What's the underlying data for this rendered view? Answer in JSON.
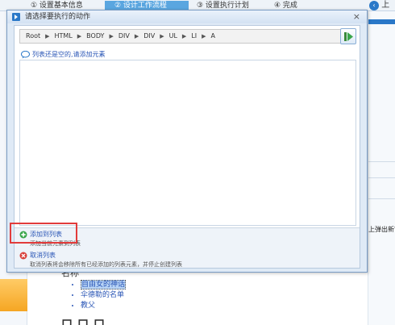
{
  "background": {
    "steps": [
      {
        "label": "① 设置基本信息"
      },
      {
        "label": "② 设计工作流程"
      },
      {
        "label": "③ 设置执行计划"
      },
      {
        "label": "④ 完成"
      }
    ],
    "nav_label": "上",
    "right_text": "上弹出新窗",
    "name_label": "名称",
    "list_items": [
      "自由女的神话",
      "伞德勒的名单",
      "教父"
    ],
    "bottom_text": "口口口"
  },
  "dialog": {
    "title": "请选择要执行的动作",
    "close_glyph": "×",
    "breadcrumb": [
      "Root",
      "HTML",
      "BODY",
      "DIV",
      "DIV",
      "UL",
      "LI",
      "A"
    ],
    "empty_message": "列表还是空的,请添加元素",
    "actions": {
      "add": {
        "label": "添加到列表",
        "desc": "添加当前元素到列表"
      },
      "cancel": {
        "label": "取消列表",
        "desc": "取消列表将会移除所有已经添加的列表元素，并停止创建列表"
      }
    }
  },
  "colors": {
    "accent": "#2a78c8",
    "link": "#2a56b6",
    "highlight": "#e23b3b",
    "add_icon": "#3aa64a",
    "cancel_icon": "#d9403a"
  },
  "icons": {
    "title": "app-icon",
    "go": "arrow-right-icon",
    "empty": "speech-bubble-icon",
    "add": "plus-circle-icon",
    "cancel": "cancel-circle-icon"
  }
}
